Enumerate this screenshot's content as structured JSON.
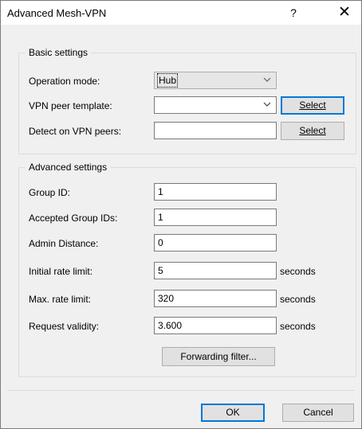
{
  "window": {
    "title": "Advanced Mesh-VPN",
    "help_glyph": "?",
    "close_glyph": "✕"
  },
  "basic": {
    "caption": "Basic settings",
    "operation_mode": {
      "label": "Operation mode:",
      "value": "Hub"
    },
    "vpn_peer_template": {
      "label": "VPN peer template:",
      "value": "",
      "button": "Select"
    },
    "detect_on_vpn_peers": {
      "label": "Detect on VPN peers:",
      "value": "",
      "button": "Select"
    }
  },
  "advanced": {
    "caption": "Advanced settings",
    "group_id": {
      "label": "Group ID:",
      "value": "1"
    },
    "accepted_group_ids": {
      "label": "Accepted Group IDs:",
      "value": "1"
    },
    "admin_distance": {
      "label": "Admin Distance:",
      "value": "0"
    },
    "initial_rate_limit": {
      "label": "Initial rate limit:",
      "value": "5",
      "unit": "seconds"
    },
    "max_rate_limit": {
      "label": "Max. rate limit:",
      "value": "320",
      "unit": "seconds"
    },
    "request_validity": {
      "label": "Request validity:",
      "value": "3.600",
      "unit": "seconds"
    },
    "forwarding_filter_button": "Forwarding filter..."
  },
  "footer": {
    "ok": "OK",
    "cancel": "Cancel"
  },
  "colors": {
    "dialog_bg": "#f0f0f0",
    "focus_border": "#0078d7"
  },
  "icons": {
    "dropdown": "chevron-down-icon"
  }
}
